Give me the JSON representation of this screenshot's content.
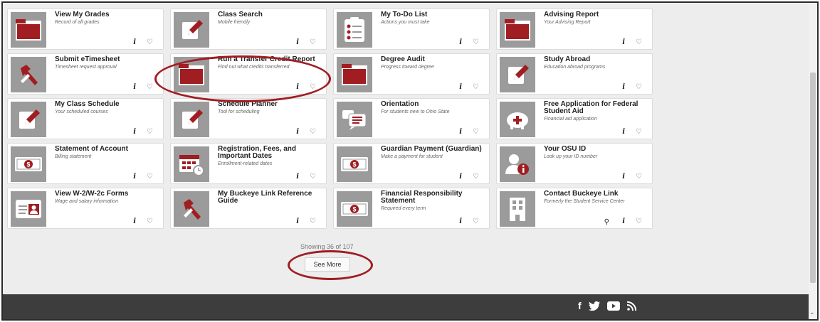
{
  "tiles": [
    {
      "title": "View My Grades",
      "subtitle": "Record of all grades",
      "icon": "folder-icon"
    },
    {
      "title": "Class Search",
      "subtitle": "Mobile friendly",
      "icon": "edit-icon"
    },
    {
      "title": "My To-Do List",
      "subtitle": "Actions you must take",
      "icon": "checklist-icon"
    },
    {
      "title": "Advising Report",
      "subtitle": "Your Advising Report",
      "icon": "folder-icon"
    },
    {
      "title": "Submit eTimesheet",
      "subtitle": "Timesheet request approval",
      "icon": "hammer-icon"
    },
    {
      "title": "Run a Transfer Credit Report",
      "subtitle": "Find out what credits transferred",
      "icon": "folder-icon"
    },
    {
      "title": "Degree Audit",
      "subtitle": "Progress toward degree",
      "icon": "folder-icon"
    },
    {
      "title": "Study Abroad",
      "subtitle": "Education abroad programs",
      "icon": "edit-icon"
    },
    {
      "title": "My Class Schedule",
      "subtitle": "Your scheduled courses",
      "icon": "edit-icon"
    },
    {
      "title": "Schedule Planner",
      "subtitle": "Tool for scheduling",
      "icon": "edit-icon"
    },
    {
      "title": "Orientation",
      "subtitle": "For students new to Ohio State",
      "icon": "chat-icon"
    },
    {
      "title": "Free Application for Federal Student Aid",
      "subtitle": "Financial aid application",
      "icon": "piggy-bank-icon"
    },
    {
      "title": "Statement of Account",
      "subtitle": "Billing statement",
      "icon": "money-icon"
    },
    {
      "title": "Registration, Fees, and Important Dates",
      "subtitle": "Enrollment-related dates",
      "icon": "calendar-icon"
    },
    {
      "title": "Guardian Payment (Guardian)",
      "subtitle": "Make a payment for student",
      "icon": "money-icon"
    },
    {
      "title": "Your OSU ID",
      "subtitle": "Look up your ID number",
      "icon": "user-info-icon"
    },
    {
      "title": "View W-2/W-2c Forms",
      "subtitle": "Wage and salary information",
      "icon": "id-card-icon"
    },
    {
      "title": "My Buckeye Link Reference Guide",
      "subtitle": "",
      "icon": "hammer-icon"
    },
    {
      "title": "Financial Responsibility Statement",
      "subtitle": "Required every term",
      "icon": "money-icon"
    },
    {
      "title": "Contact Buckeye Link",
      "subtitle": "Formerly the Student Service Center",
      "icon": "building-icon",
      "location": true
    }
  ],
  "tile_actions": {
    "info": "i",
    "favorite": "♡",
    "location": "⚲"
  },
  "pagination": {
    "showing": "Showing 36 of 107",
    "see_more": "See More"
  },
  "footer": {
    "social": [
      "f",
      "🐦",
      "▶",
      "rss"
    ]
  },
  "colors": {
    "accent": "#a01d22",
    "icon_bg": "#9b9b9b",
    "footer_bg": "#3d3d3d",
    "page_bg": "#ededed"
  }
}
